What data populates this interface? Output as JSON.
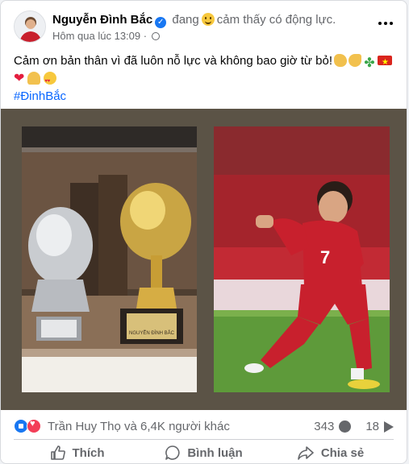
{
  "post": {
    "author": "Nguyễn Đình Bắc",
    "status_prefix": "đang",
    "status_text": "cảm thấy có động lực.",
    "time": "Hôm qua lúc 13:09",
    "body_text": "Cảm ơn bản thân vì đã luôn nỗ lực và không bao giờ từ bỏ!",
    "hashtag": "#ĐinhBắc",
    "emojis": [
      "clap-emoji",
      "muscle-emoji",
      "clover-emoji",
      "vietnam-flag-emoji",
      "heart-emoji",
      "pray-emoji",
      "heart-eyes-emoji"
    ]
  },
  "reactions": {
    "summary": "Trần Huy Thọ và 6,4K người khác",
    "comments": "343",
    "shares": "18"
  },
  "actions": {
    "like": "Thích",
    "comment": "Bình luận",
    "share": "Chia sẻ"
  },
  "colors": {
    "accent": "#1877f2",
    "hashtag": "#0866ff",
    "photo_frame": "#5b5346",
    "jersey_red": "#c8202d"
  },
  "photos": {
    "left_plaque_label": "NGUYỄN ĐÌNH BẮC",
    "right_jersey_number": "7"
  }
}
